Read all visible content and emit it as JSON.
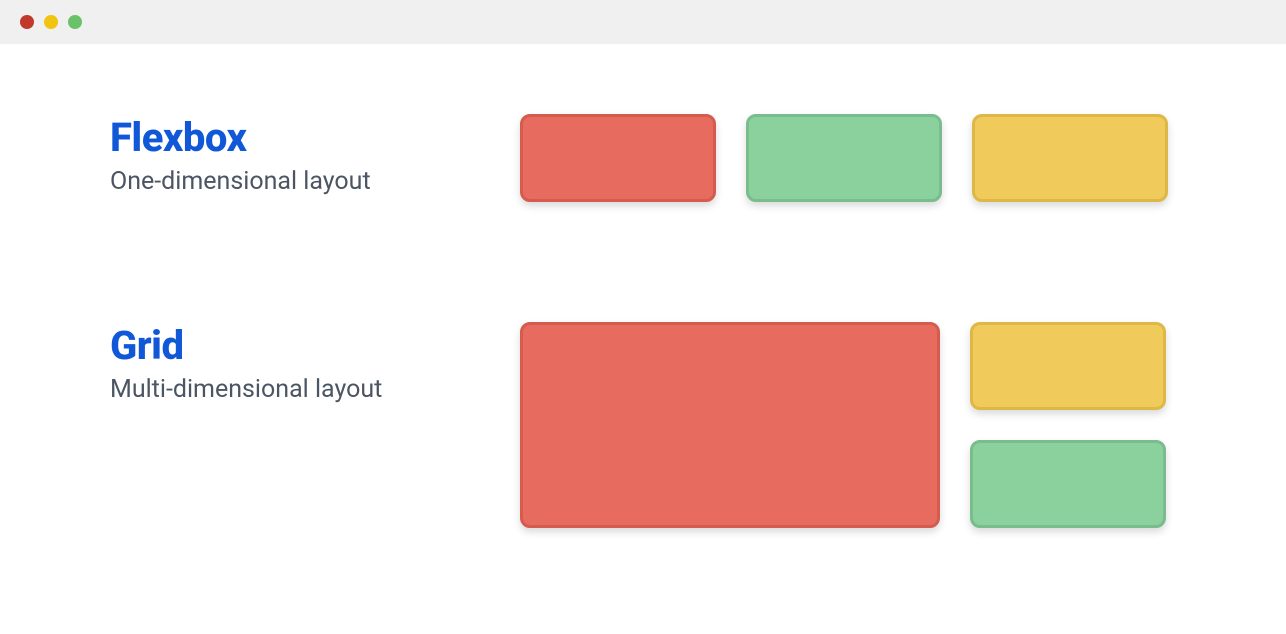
{
  "sections": {
    "flexbox": {
      "title": "Flexbox",
      "subtitle": "One-dimensional layout"
    },
    "grid": {
      "title": "Grid",
      "subtitle": "Multi-dimensional layout"
    }
  },
  "colors": {
    "red": "#e76c5f",
    "green": "#8bd19e",
    "yellow": "#f0ca5a",
    "title_blue": "#1058d8",
    "subtitle_gray": "#4b5563"
  }
}
